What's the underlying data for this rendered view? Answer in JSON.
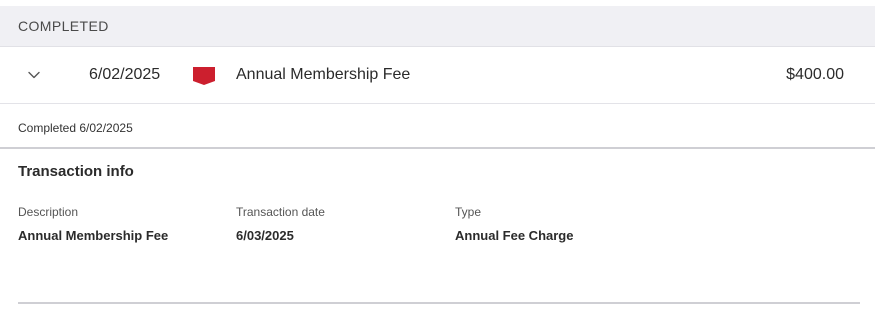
{
  "section": {
    "title": "COMPLETED"
  },
  "transaction": {
    "date": "6/02/2025",
    "description": "Annual Membership Fee",
    "amount": "$400.00",
    "card_icon": "red-card-icon",
    "card_color": "#cc1f2e"
  },
  "status": {
    "text": "Completed 6/02/2025"
  },
  "info": {
    "title": "Transaction info",
    "fields": [
      {
        "label": "Description",
        "value": "Annual Membership Fee"
      },
      {
        "label": "Transaction date",
        "value": "6/03/2025"
      },
      {
        "label": "Type",
        "value": "Annual Fee Charge"
      }
    ]
  }
}
